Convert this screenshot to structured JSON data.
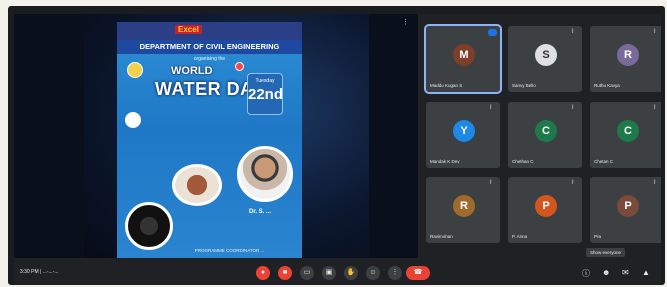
{
  "slide": {
    "brand": "Excel",
    "department": "DEPARTMENT OF CIVIL ENGINEERING",
    "organised_by": "organising the",
    "title_line1": "WORLD",
    "title_line2": "WATER DAY",
    "date_day": "Tuesday",
    "date_number": "22nd",
    "speaker_name": "Dr. S. ...",
    "footer": "PROGRAMME COORDINATOR ..."
  },
  "participants": [
    {
      "name": "Maddu Kugan S",
      "initial": "M",
      "color": "#7b3f2a",
      "speaking": true
    },
    {
      "name": "Sanvy Bello",
      "initial": "S",
      "color": "#f0f0f0",
      "speaking": false
    },
    {
      "name": "Ruthu Kavya",
      "initial": "R",
      "color": "#7a6a9c",
      "speaking": false
    },
    {
      "name": "Mandak K Dev",
      "initial": "Y",
      "color": "#1e88e5",
      "speaking": false
    },
    {
      "name": "Chethan C",
      "initial": "C",
      "color": "#1e7a4a",
      "speaking": false
    },
    {
      "name": "Chetan C",
      "initial": "C",
      "color": "#1e7a4a",
      "speaking": false
    },
    {
      "name": "Ravimohan",
      "initial": "R",
      "color": "#a06a2c",
      "speaking": false
    },
    {
      "name": "P. Anna",
      "initial": "P",
      "color": "#d2561e",
      "speaking": false
    },
    {
      "name": "Pra",
      "initial": "P",
      "color": "#7a4a3a",
      "speaking": false
    }
  ],
  "bottombar": {
    "meeting_info": "3:30 PM | ...-...-...",
    "tooltip": "Show everyone",
    "end_call_icon": "phone-hangup-icon"
  }
}
